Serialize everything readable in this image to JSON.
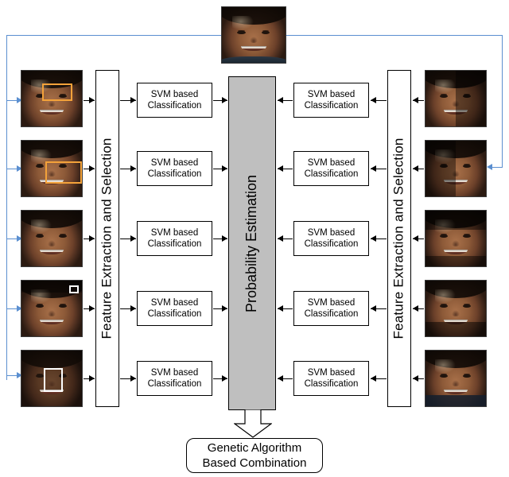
{
  "diagram": {
    "title": "Multimodal face recognition fusion pipeline",
    "colors": {
      "flow_line": "#000000",
      "feedback_line": "#5b8fd0",
      "probability_box_fill": "#bfbfbf",
      "roi_highlight": "#f3a23a"
    },
    "top_input": {
      "name": "probe-face-image",
      "caption": ""
    },
    "left_column": {
      "feature_block_label": "Feature  Extraction and Selection",
      "thumbnails": [
        {
          "name": "left-face-eye-region",
          "roi": true
        },
        {
          "name": "left-face-eye-nose-region",
          "roi": true
        },
        {
          "name": "left-face-full",
          "roi": false
        },
        {
          "name": "left-face-dark",
          "roi": false
        },
        {
          "name": "left-face-nose-region",
          "roi": true
        }
      ],
      "classifiers": [
        {
          "line1": "SVM based",
          "line2": "Classification"
        },
        {
          "line1": "SVM based",
          "line2": "Classification"
        },
        {
          "line1": "SVM based",
          "line2": "Classification"
        },
        {
          "line1": "SVM based",
          "line2": "Classification"
        },
        {
          "line1": "SVM based",
          "line2": "Classification"
        }
      ]
    },
    "right_column": {
      "feature_block_label": "Feature  Extraction and Selection",
      "thumbnails": [
        {
          "name": "right-face-left-half-dark",
          "split": "right"
        },
        {
          "name": "right-face-right-half-dark",
          "split": "left"
        },
        {
          "name": "right-face-band-dark",
          "split": "bands"
        },
        {
          "name": "right-face-full",
          "split": "none"
        },
        {
          "name": "right-face-bottom-dark",
          "split": "bottom"
        }
      ],
      "classifiers": [
        {
          "line1": "SVM based",
          "line2": "Classification"
        },
        {
          "line1": "SVM based",
          "line2": "Classification"
        },
        {
          "line1": "SVM based",
          "line2": "Classification"
        },
        {
          "line1": "SVM based",
          "line2": "Classification"
        },
        {
          "line1": "SVM based",
          "line2": "Classification"
        }
      ]
    },
    "center": {
      "probability_label": "Probability Estimation"
    },
    "output": {
      "line1": "Genetic Algorithm",
      "line2": "Based Combination"
    }
  }
}
